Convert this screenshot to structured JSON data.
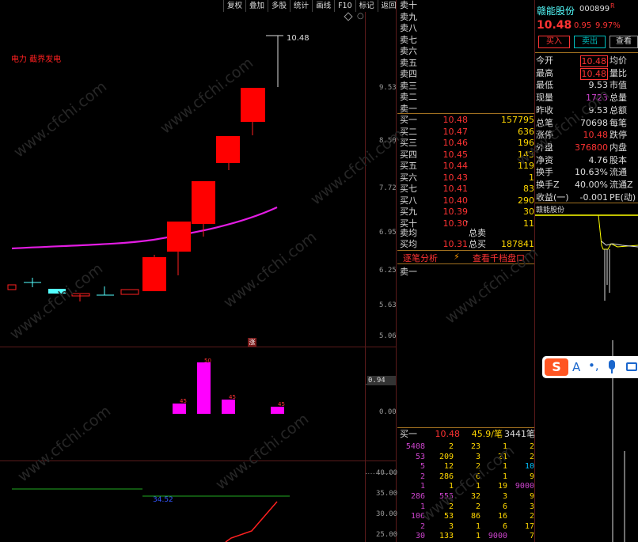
{
  "toolbar": {
    "items": [
      "复权",
      "叠加",
      "多股",
      "统计",
      "画线",
      "F10",
      "标记",
      "返回"
    ]
  },
  "chart": {
    "indicator_label": "电力 截界发电",
    "high_label": "10.48",
    "price_axis": [
      "9.53",
      "8.50",
      "7.72",
      "6.95",
      "6.25",
      "5.63",
      "5.06"
    ],
    "vol_axis": [
      "0.94",
      "0.00"
    ],
    "osc_axis": [
      "40.00",
      "35.00",
      "30.00",
      "25.00"
    ],
    "osc_value": "34.52",
    "event_marker": "涨",
    "vol_bar_labels": [
      "45",
      "50",
      "45",
      "45"
    ],
    "colors": {
      "up": "#ff0000",
      "down": "#54ffff",
      "ma": "#e31ce3",
      "grid": "#5a1a1a"
    }
  },
  "orderbook": {
    "sell_labels": [
      "卖十",
      "卖九",
      "卖八",
      "卖七",
      "卖六",
      "卖五",
      "卖四",
      "卖三",
      "卖二",
      "卖一"
    ],
    "buy_rows": [
      {
        "label": "买一",
        "price": "10.48",
        "vol": "157795"
      },
      {
        "label": "买二",
        "price": "10.47",
        "vol": "636"
      },
      {
        "label": "买三",
        "price": "10.46",
        "vol": "196"
      },
      {
        "label": "买四",
        "price": "10.45",
        "vol": "143"
      },
      {
        "label": "买五",
        "price": "10.44",
        "vol": "119"
      },
      {
        "label": "买六",
        "price": "10.43",
        "vol": "1"
      },
      {
        "label": "买七",
        "price": "10.41",
        "vol": "83"
      },
      {
        "label": "买八",
        "price": "10.40",
        "vol": "290"
      },
      {
        "label": "买九",
        "price": "10.39",
        "vol": "30"
      },
      {
        "label": "买十",
        "price": "10.30",
        "vol": "11"
      }
    ],
    "buy10_flag": "-",
    "sell_avg_label": "卖均",
    "sell_total_label": "总卖",
    "buy_avg_label": "买均",
    "buy_avg": "10.31",
    "buy_total_label": "总买",
    "buy_total": "187841",
    "tab_trades": "逐笔分析",
    "tab_depth": "查看千档盘口",
    "bottom_label": "卖一"
  },
  "ticks": {
    "header": {
      "label": "买一",
      "price": "10.48",
      "per": "45.9/笔",
      "count": "3441",
      "unit": "笔"
    },
    "rows": [
      [
        "5408",
        "2",
        "23",
        "1",
        "2"
      ],
      [
        "53",
        "209",
        "3",
        "21",
        "2"
      ],
      [
        "5",
        "12",
        "2",
        "1",
        "10"
      ],
      [
        "2",
        "286",
        "6",
        "1",
        "9"
      ],
      [
        "1",
        "1",
        "1",
        "19",
        "9000"
      ],
      [
        "286",
        "555",
        "32",
        "3",
        "9"
      ],
      [
        "1",
        "2",
        "2",
        "6",
        "3"
      ],
      [
        "106",
        "53",
        "86",
        "16",
        "2"
      ],
      [
        "2",
        "3",
        "1",
        "6",
        "17"
      ],
      [
        "30",
        "133",
        "1",
        "9000",
        "7"
      ]
    ]
  },
  "stock": {
    "name": "赣能股份",
    "code": "000899",
    "badge": "R",
    "price": "10.48",
    "change": "0.95",
    "pct": "9.97%",
    "buy_btn": "买入",
    "sell_btn": "卖出",
    "more_btn": "查看",
    "stats": [
      {
        "l": "今开",
        "v": "10.48",
        "r": "均价",
        "box": true,
        "color": "#ff3333"
      },
      {
        "l": "最高",
        "v": "10.48",
        "r": "量比",
        "box": true,
        "color": "#ff3333"
      },
      {
        "l": "最低",
        "v": "9.53",
        "r": "市值",
        "color": "#dddddd"
      },
      {
        "l": "现量",
        "v": "1723",
        "r": "总量",
        "color": "#cc44cc"
      },
      {
        "l": "昨收",
        "v": "9.53",
        "r": "总额",
        "color": "#dddddd"
      },
      {
        "l": "总笔",
        "v": "70698",
        "r": "每笔",
        "color": "#dddddd"
      },
      {
        "l": "涨停",
        "v": "10.48",
        "r": "跌停",
        "color": "#ff3333"
      },
      {
        "l": "外盘",
        "v": "376800",
        "r": "内盘",
        "color": "#ff3333"
      },
      {
        "l": "净资",
        "v": "4.76",
        "r": "股本",
        "color": "#dddddd"
      },
      {
        "l": "换手",
        "v": "10.63%",
        "r": "流通",
        "color": "#dddddd"
      },
      {
        "l": "换手Z",
        "v": "40.00%",
        "r": "流通Z",
        "color": "#dddddd"
      },
      {
        "l": "收益(一)",
        "v": "-0.001",
        "r": "PE(动)",
        "color": "#dddddd"
      }
    ],
    "mini_label": "赣能股份"
  },
  "ime": {
    "logo": "S",
    "letter": "A",
    "punct": "•,"
  }
}
